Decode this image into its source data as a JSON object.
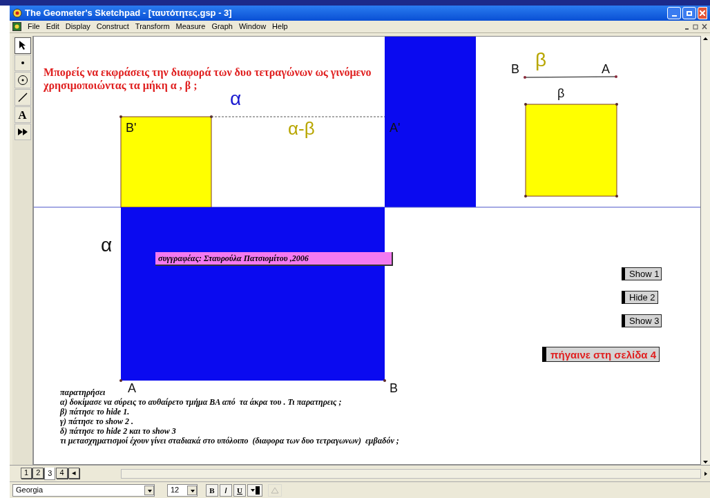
{
  "window": {
    "title": "The Geometer's Sketchpad - [ταυτότητες.gsp - 3]"
  },
  "menu": [
    "File",
    "Edit",
    "Display",
    "Construct",
    "Transform",
    "Measure",
    "Graph",
    "Window",
    "Help"
  ],
  "toolbox": [
    {
      "kind": "arrow",
      "selected": true
    },
    {
      "kind": "point",
      "selected": false
    },
    {
      "kind": "compass",
      "selected": false
    },
    {
      "kind": "line",
      "selected": false
    },
    {
      "kind": "text",
      "label": "A",
      "selected": false
    },
    {
      "kind": "custom",
      "selected": false
    }
  ],
  "canvas": {
    "question": [
      "Μπορείς να εκφράσεις την διαφορά των δυο τετραγώνων ως γινόμενο",
      "χρησιμοποιώντας τα μήκη   α , β ;"
    ],
    "labels": [
      {
        "text": "α",
        "color": "#1a1ad0"
      },
      {
        "text": "B'",
        "color": "#111111"
      },
      {
        "text": "α-β",
        "color": "#b8a600"
      },
      {
        "text": "A'",
        "color": "#111111"
      },
      {
        "text": "α",
        "color": "#111111"
      },
      {
        "text": "B",
        "color": "#111111"
      },
      {
        "text": "β",
        "color": "#b8a600"
      },
      {
        "text": "A",
        "color": "#111111"
      },
      {
        "text": "β",
        "color": "#111111"
      },
      {
        "text": "A",
        "color": "#111111"
      },
      {
        "text": "B",
        "color": "#111111"
      }
    ],
    "caption": "συγγραφέας: Σταυρούλα Πατσιομίτου ,2006",
    "buttons": [
      "Show 1",
      "Hide 2",
      "Show 3"
    ],
    "page_link": "πήγαινε στη σελίδα 4",
    "notes": [
      "παρατηρήσει",
      "α) δοκίμασε να σύρεις το αυθαίρετο τμήμα ΒΑ από  τα άκρα του . Τι παρατηρεις ;",
      "β) πάτησε το hide 1.",
      "γ) πάτησε το show 2 .",
      "δ) πάτησε το hide 2 και το show 3",
      "τι μετασχηματισμοί έχουν γίνει σταδιακά στο υπόλοιπο  (διαφορα των δυο τετραγωνων)  εμβαδόν ;"
    ]
  },
  "page_tabs": [
    {
      "label": "1",
      "selected": false
    },
    {
      "label": "2",
      "selected": false
    },
    {
      "label": "3",
      "selected": true
    },
    {
      "label": "4",
      "selected": false
    },
    {
      "label": "◂",
      "selected": false
    }
  ],
  "format_bar": {
    "font": "Georgia",
    "size": "12",
    "bold": "B",
    "italic": "/",
    "underline": "U"
  }
}
